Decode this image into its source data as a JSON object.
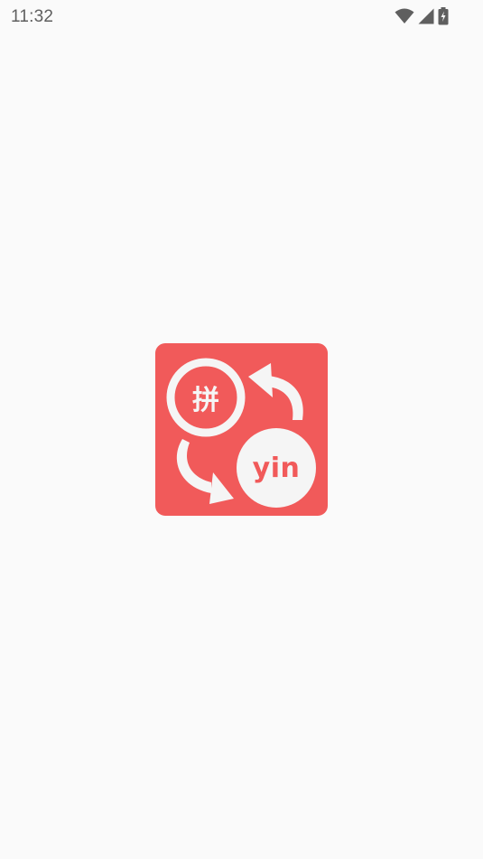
{
  "status_bar": {
    "time": "11:32",
    "icons": [
      "wifi-icon",
      "cell-signal-icon",
      "battery-charging-icon"
    ]
  },
  "splash": {
    "logo_char": "拼",
    "logo_word": "yin",
    "colors": {
      "background": "#fafafa",
      "logo_background": "#f15a5a",
      "logo_foreground": "#f5f5f5"
    }
  }
}
